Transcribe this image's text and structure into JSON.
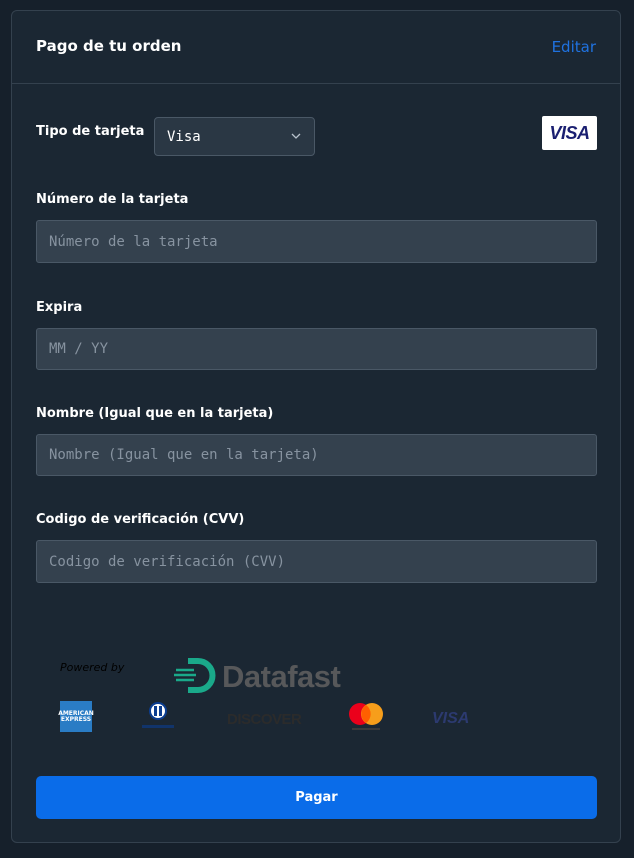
{
  "header": {
    "title": "Pago de tu orden",
    "edit_label": "Editar"
  },
  "card_type": {
    "label": "Tipo de tarjeta",
    "selected": "Visa",
    "badge_icon": "visa-logo",
    "badge_text": "VISA"
  },
  "fields": {
    "card_number": {
      "label": "Número de la tarjeta",
      "placeholder": "Número de la tarjeta",
      "value": ""
    },
    "expiry": {
      "label": "Expira",
      "placeholder": "MM / YY",
      "value": ""
    },
    "name": {
      "label": "Nombre (Igual que en la tarjeta)",
      "placeholder": "Nombre (Igual que en la tarjeta)",
      "value": ""
    },
    "cvv": {
      "label": "Codigo de verificación (CVV)",
      "placeholder": "Codigo de verificación (CVV)",
      "value": ""
    }
  },
  "footer": {
    "powered_by": "Powered by",
    "provider": "Datafast",
    "brands": {
      "amex": "AMERICAN EXPRESS",
      "discover": "DISCOVER",
      "visa": "VISA"
    }
  },
  "pay_button": {
    "label": "Pagar"
  },
  "colors": {
    "background": "#16202b",
    "card": "#1b2733",
    "input": "#34414e",
    "accent": "#0a6ce9",
    "link": "#1f72e0"
  }
}
